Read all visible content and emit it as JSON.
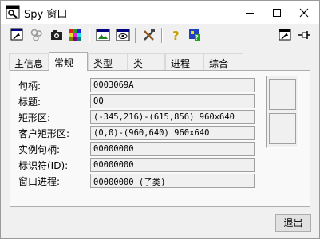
{
  "window": {
    "title": "Spy 窗口"
  },
  "toolbar": {
    "tools": [
      {
        "icon": "window-finder-icon"
      },
      {
        "icon": "gear-cluster-icon"
      },
      {
        "icon": "camera-icon"
      },
      {
        "icon": "color-palette-icon"
      },
      {
        "icon": "window-image-icon"
      },
      {
        "icon": "window-eye-icon"
      },
      {
        "icon": "tools-icon"
      },
      {
        "icon": "help-icon"
      },
      {
        "icon": "about-icon"
      },
      {
        "icon": "pick-window-icon"
      },
      {
        "icon": "pin-icon"
      }
    ]
  },
  "tabs": [
    {
      "label": "主信息",
      "active": false
    },
    {
      "label": "常规",
      "active": true
    },
    {
      "label": "类型",
      "active": false
    },
    {
      "label": "类",
      "active": false
    },
    {
      "label": "进程",
      "active": false
    },
    {
      "label": "综合",
      "active": false
    }
  ],
  "fields": [
    {
      "label": "句柄:",
      "value": "0003069A"
    },
    {
      "label": "标题:",
      "value": "QQ"
    },
    {
      "label": "矩形区:",
      "value": "(-345,216)-(615,856) 960x640"
    },
    {
      "label": "客户矩形区:",
      "value": "(0,0)-(960,640) 960x640"
    },
    {
      "label": "实例句柄:",
      "value": "00000000"
    },
    {
      "label": "标识符(ID):",
      "value": "00000000"
    },
    {
      "label": "窗口进程:",
      "value": "00000000 (子类)"
    }
  ],
  "buttons": {
    "exit": "退出"
  }
}
